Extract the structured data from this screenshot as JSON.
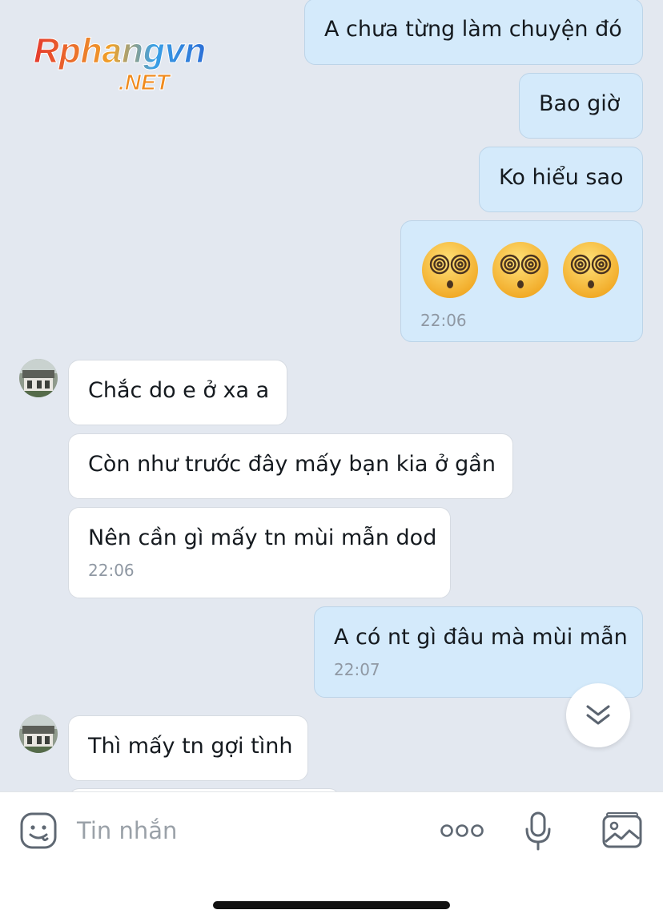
{
  "watermark": {
    "brand": "Rphangvn",
    "tld": ".NET"
  },
  "messages": [
    {
      "dir": "out",
      "text": "A chưa từng làm chuyện đó"
    },
    {
      "dir": "out",
      "text": "Bao giờ"
    },
    {
      "dir": "out",
      "text": "Ko hiểu sao"
    },
    {
      "dir": "out",
      "emoji": "😵 😵 😵",
      "time": "22:06"
    },
    {
      "dir": "in",
      "text": "Chắc do e ở xa a"
    },
    {
      "dir": "in",
      "text": "Còn như trước đây mấy bạn kia ở gần"
    },
    {
      "dir": "in",
      "text": "Nên cần gì mấy tn mùi mẫn dod",
      "time": "22:06"
    },
    {
      "dir": "out",
      "text": "A có nt gì đâu mà mùi mẫn",
      "time": "22:07"
    },
    {
      "dir": "in",
      "text": "Thì mấy tn gợi tình"
    }
  ],
  "input": {
    "placeholder": "Tin nhắn"
  },
  "icons": {
    "sticker": "sticker-face-icon",
    "more": "more-dots-icon",
    "mic": "microphone-icon",
    "image": "image-gallery-icon",
    "scroll": "double-chevron-down-icon"
  },
  "colors": {
    "outgoing_bubble": "#d4eafb",
    "incoming_bubble": "#ffffff",
    "background": "#e3e8f0"
  }
}
